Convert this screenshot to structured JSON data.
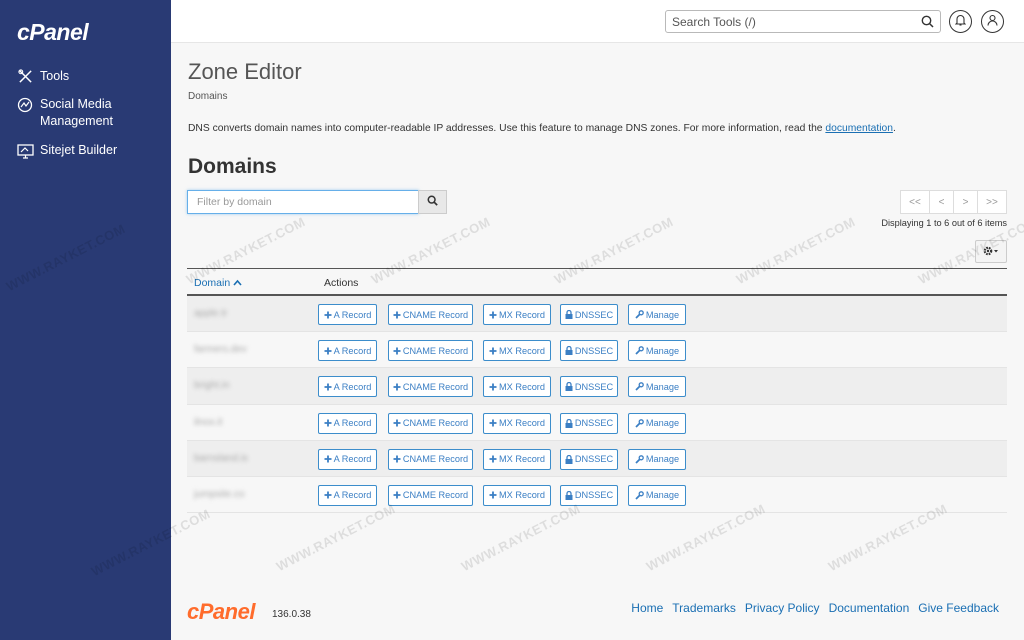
{
  "sidebar": {
    "logo": "cPanel",
    "items": [
      {
        "label": "Tools",
        "icon": "tools-icon"
      },
      {
        "label": "Social Media Management",
        "icon": "social-media-icon"
      },
      {
        "label": "Sitejet Builder",
        "icon": "sitejet-icon"
      }
    ]
  },
  "topbar": {
    "search_placeholder": "Search Tools (/)"
  },
  "page": {
    "title": "Zone Editor",
    "breadcrumb": "Domains",
    "description": "DNS converts domain names into computer-readable IP addresses. Use this feature to manage DNS zones. For more information, read the ",
    "description_link": "documentation",
    "description_end": ".",
    "section_title": "Domains"
  },
  "filter": {
    "placeholder": "Filter by domain"
  },
  "pagination": {
    "first": "<<",
    "prev": "<",
    "next": ">",
    "last": ">>",
    "displaying": "Displaying 1 to 6 out of 6 items"
  },
  "table": {
    "col_domain": "Domain",
    "col_actions": "Actions",
    "actions": {
      "a_record": "A Record",
      "cname_record": "CNAME Record",
      "mx_record": "MX Record",
      "dnssec": "DNSSEC",
      "manage": "Manage"
    },
    "rows": [
      {
        "domain": "apple.tr"
      },
      {
        "domain": "farmers.dev"
      },
      {
        "domain": "bright.in"
      },
      {
        "domain": "ilnox.it"
      },
      {
        "domain": "barnsland.is"
      },
      {
        "domain": "jumpsite.co"
      }
    ]
  },
  "watermark": "WWW.RAYKET.COM",
  "footer": {
    "logo": "cPanel",
    "version": "136.0.38",
    "links": [
      "Home",
      "Trademarks",
      "Privacy Policy",
      "Documentation",
      "Give Feedback"
    ]
  },
  "colors": {
    "sidebar_bg": "#293a74",
    "link": "#1a6fb3",
    "footer_logo": "#ff6c2c"
  }
}
